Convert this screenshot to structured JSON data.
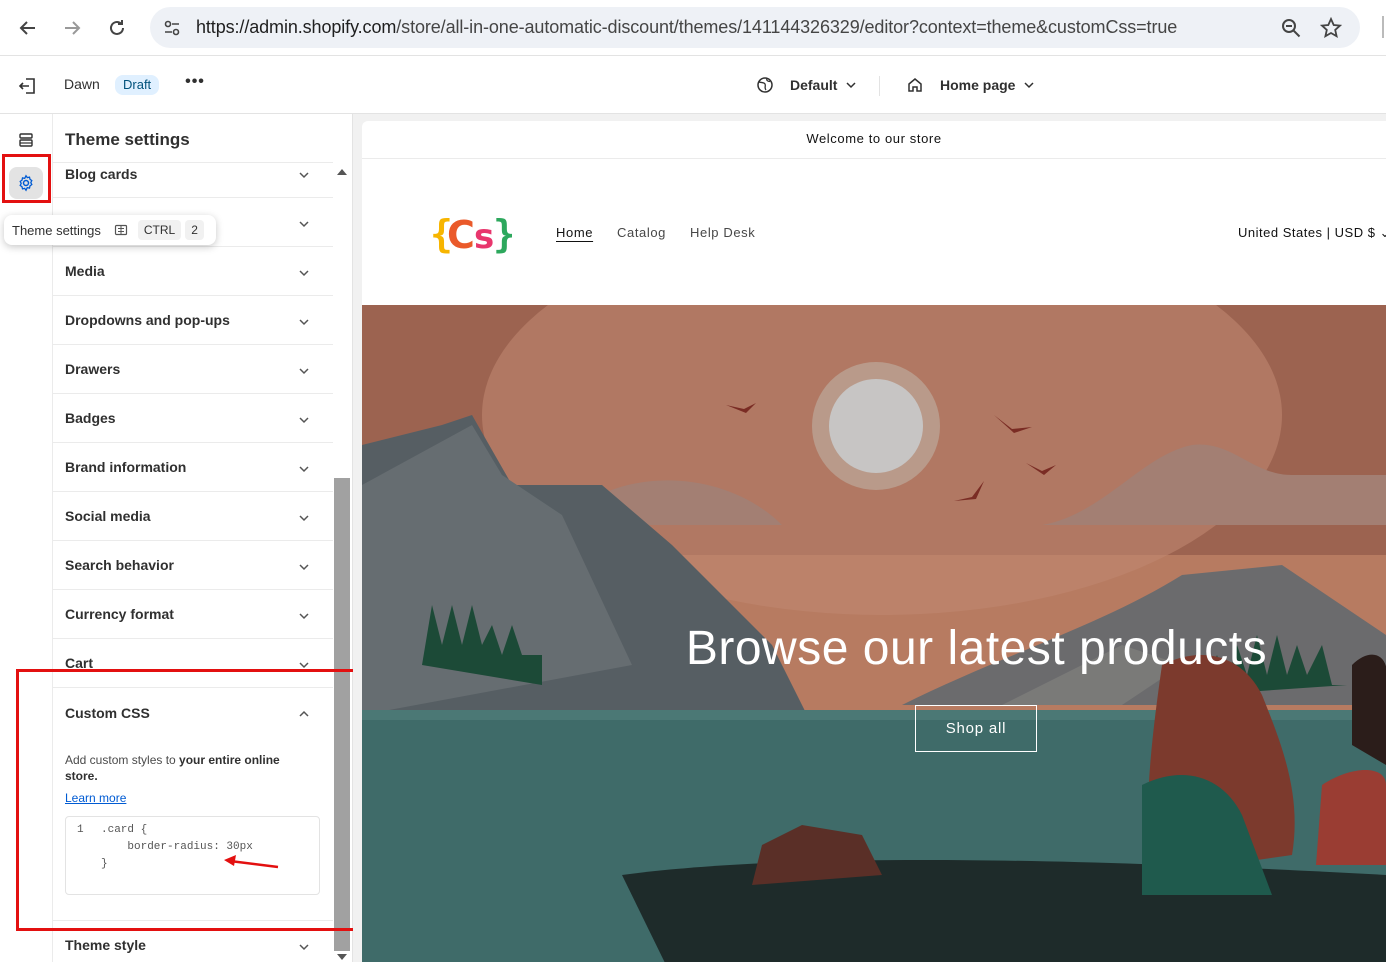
{
  "browser": {
    "url_host": "https://admin.shopify.com",
    "url_path": "/store/all-in-one-automatic-discount/themes/141144326329/editor?context=theme&customCss=true"
  },
  "topbar": {
    "theme_name": "Dawn",
    "badge": "Draft",
    "more": "•••",
    "device_selector": "Default",
    "page_selector": "Home page"
  },
  "tooltip": {
    "label": "Theme settings",
    "key1": "CTRL",
    "key2": "2"
  },
  "panel": {
    "title": "Theme settings",
    "sections": [
      {
        "label": "Blog cards"
      },
      {
        "label": ""
      },
      {
        "label": "Media"
      },
      {
        "label": "Dropdowns and pop-ups"
      },
      {
        "label": "Drawers"
      },
      {
        "label": "Badges"
      },
      {
        "label": "Brand information"
      },
      {
        "label": "Social media"
      },
      {
        "label": "Search behavior"
      },
      {
        "label": "Currency format"
      },
      {
        "label": "Cart"
      }
    ],
    "custom_css": {
      "label": "Custom CSS",
      "desc_plain": "Add custom styles to ",
      "desc_bold": "your entire online store.",
      "learn_more": "Learn more",
      "code": {
        "line_number": "1",
        "line1": ".card {",
        "line2": "    border-radius: 30px",
        "line3": "}"
      }
    },
    "last_section": "Theme style"
  },
  "preview": {
    "announcement": "Welcome to our store",
    "nav": [
      "Home",
      "Catalog",
      "Help Desk"
    ],
    "locale": "United States | USD $",
    "hero_title": "Browse our latest products",
    "hero_button": "Shop all"
  },
  "colors": {
    "highlight": "#e31010",
    "badge_bg": "#e0f0ff",
    "link": "#005bd3"
  }
}
